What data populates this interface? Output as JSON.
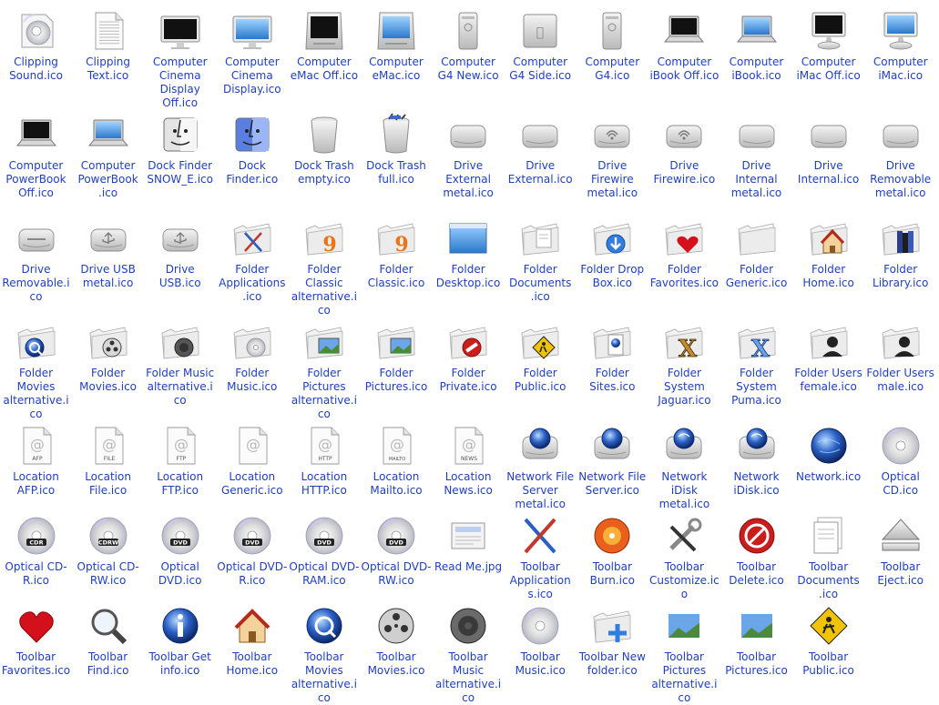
{
  "colors": {
    "label": "#1f3fc0",
    "background": "#ffffff",
    "folder": "#e8e8e8",
    "drive": "#d8d8d8",
    "screen_on": "#4da3e8",
    "screen_off": "#111111",
    "globe": "#2a5fc4",
    "heart": "#d4101c",
    "stop": "#cc1d1d"
  },
  "icons": [
    {
      "label": "Clipping Sound.ico",
      "kind": "clip-sound"
    },
    {
      "label": "Clipping Text.ico",
      "kind": "clip-text"
    },
    {
      "label": "Computer Cinema Display Off.ico",
      "kind": "display-off"
    },
    {
      "label": "Computer Cinema Display.ico",
      "kind": "display-on"
    },
    {
      "label": "Computer eMac Off.ico",
      "kind": "emac-off"
    },
    {
      "label": "Computer eMac.ico",
      "kind": "emac-on"
    },
    {
      "label": "Computer G4 New.ico",
      "kind": "g4-tower"
    },
    {
      "label": "Computer G4 Side.ico",
      "kind": "g4-side"
    },
    {
      "label": "Computer G4.ico",
      "kind": "g4-tower"
    },
    {
      "label": "Computer iBook Off.ico",
      "kind": "laptop-off"
    },
    {
      "label": "Computer iBook.ico",
      "kind": "laptop-on"
    },
    {
      "label": "Computer iMac Off.ico",
      "kind": "imac-off"
    },
    {
      "label": "Computer iMac.ico",
      "kind": "imac-on"
    },
    {
      "label": "Computer PowerBook Off.ico",
      "kind": "laptop-off"
    },
    {
      "label": "Computer PowerBook .ico",
      "kind": "laptop-on"
    },
    {
      "label": "Dock Finder SNOW_E.ico",
      "kind": "finder-snow"
    },
    {
      "label": "Dock Finder.ico",
      "kind": "finder"
    },
    {
      "label": "Dock Trash empty.ico",
      "kind": "trash-empty"
    },
    {
      "label": "Dock Trash full.ico",
      "kind": "trash-full"
    },
    {
      "label": "Drive External metal.ico",
      "kind": "drive"
    },
    {
      "label": "Drive External.ico",
      "kind": "drive"
    },
    {
      "label": "Drive Firewire metal.ico",
      "kind": "drive-firewire"
    },
    {
      "label": "Drive Firewire.ico",
      "kind": "drive-firewire"
    },
    {
      "label": "Drive Internal metal.ico",
      "kind": "drive"
    },
    {
      "label": "Drive Internal.ico",
      "kind": "drive"
    },
    {
      "label": "Drive Removable metal.ico",
      "kind": "drive"
    },
    {
      "label": "Drive Removable.ico",
      "kind": "drive-removable"
    },
    {
      "label": "Drive USB metal.ico",
      "kind": "drive-usb"
    },
    {
      "label": "Drive USB.ico",
      "kind": "drive-usb"
    },
    {
      "label": "Folder Applications.ico",
      "kind": "folder-apps"
    },
    {
      "label": "Folder Classic alternative.ico",
      "kind": "folder-classic"
    },
    {
      "label": "Folder Classic.ico",
      "kind": "folder-classic"
    },
    {
      "label": "Folder Desktop.ico",
      "kind": "folder-desktop"
    },
    {
      "label": "Folder Documents .ico",
      "kind": "folder-docs"
    },
    {
      "label": "Folder Drop Box.ico",
      "kind": "folder-drop"
    },
    {
      "label": "Folder Favorites.ico",
      "kind": "folder-fav"
    },
    {
      "label": "Folder Generic.ico",
      "kind": "folder"
    },
    {
      "label": "Folder Home.ico",
      "kind": "folder-home"
    },
    {
      "label": "Folder Library.ico",
      "kind": "folder-library"
    },
    {
      "label": "Folder Movies alternative.ico",
      "kind": "folder-qt"
    },
    {
      "label": "Folder Movies.ico",
      "kind": "folder-reel"
    },
    {
      "label": "Folder Music alternative.ico",
      "kind": "folder-speaker"
    },
    {
      "label": "Folder Music.ico",
      "kind": "folder-cd"
    },
    {
      "label": "Folder Pictures alternative.ico",
      "kind": "folder-pics"
    },
    {
      "label": "Folder Pictures.ico",
      "kind": "folder-pics"
    },
    {
      "label": "Folder Private.ico",
      "kind": "folder-private"
    },
    {
      "label": "Folder Public.ico",
      "kind": "folder-public"
    },
    {
      "label": "Folder Sites.ico",
      "kind": "folder-sites"
    },
    {
      "label": "Folder System Jaguar.ico",
      "kind": "folder-x-jaguar"
    },
    {
      "label": "Folder System Puma.ico",
      "kind": "folder-x-puma"
    },
    {
      "label": "Folder Users female.ico",
      "kind": "folder-user-f"
    },
    {
      "label": "Folder Users male.ico",
      "kind": "folder-user-m"
    },
    {
      "label": "Location AFP.ico",
      "kind": "loc",
      "tag": "AFP"
    },
    {
      "label": "Location File.ico",
      "kind": "loc",
      "tag": "FILE"
    },
    {
      "label": "Location FTP.ico",
      "kind": "loc",
      "tag": "FTP"
    },
    {
      "label": "Location Generic.ico",
      "kind": "loc",
      "tag": ""
    },
    {
      "label": "Location HTTP.ico",
      "kind": "loc",
      "tag": "HTTP"
    },
    {
      "label": "Location Mailto.ico",
      "kind": "loc",
      "tag": "MAILTO"
    },
    {
      "label": "Location News.ico",
      "kind": "loc",
      "tag": "NEWS"
    },
    {
      "label": "Network File Server metal.ico",
      "kind": "net-server"
    },
    {
      "label": "Network File Server.ico",
      "kind": "net-server"
    },
    {
      "label": "Network iDisk metal.ico",
      "kind": "net-idisk"
    },
    {
      "label": "Network iDisk.ico",
      "kind": "net-idisk"
    },
    {
      "label": "Network.ico",
      "kind": "globe"
    },
    {
      "label": "Optical CD.ico",
      "kind": "cd",
      "tag": ""
    },
    {
      "label": "Optical CD-R.ico",
      "kind": "cd",
      "tag": "CDR"
    },
    {
      "label": "Optical CD-RW.ico",
      "kind": "cd",
      "tag": "CDRW"
    },
    {
      "label": "Optical DVD.ico",
      "kind": "cd",
      "tag": "DVD"
    },
    {
      "label": "Optical DVD-R.ico",
      "kind": "cd",
      "tag": "DVD"
    },
    {
      "label": "Optical DVD-RAM.ico",
      "kind": "cd",
      "tag": "DVD"
    },
    {
      "label": "Optical DVD-RW.ico",
      "kind": "cd",
      "tag": "DVD"
    },
    {
      "label": "Read Me.jpg",
      "kind": "readme"
    },
    {
      "label": "Toolbar Application s.ico",
      "kind": "tb-apps"
    },
    {
      "label": "Toolbar Burn.ico",
      "kind": "tb-burn"
    },
    {
      "label": "Toolbar Customize.ico",
      "kind": "tb-tools"
    },
    {
      "label": "Toolbar Delete.ico",
      "kind": "tb-delete"
    },
    {
      "label": "Toolbar Documents .ico",
      "kind": "tb-docs"
    },
    {
      "label": "Toolbar Eject.ico",
      "kind": "tb-eject"
    },
    {
      "label": "Toolbar Favorites.ico",
      "kind": "tb-heart"
    },
    {
      "label": "Toolbar Find.ico",
      "kind": "tb-find"
    },
    {
      "label": "Toolbar Get info.ico",
      "kind": "tb-info"
    },
    {
      "label": "Toolbar Home.ico",
      "kind": "tb-home"
    },
    {
      "label": "Toolbar Movies alternative.ico",
      "kind": "tb-qt"
    },
    {
      "label": "Toolbar Movies.ico",
      "kind": "tb-reel"
    },
    {
      "label": "Toolbar Music alternative.ico",
      "kind": "tb-speaker"
    },
    {
      "label": "Toolbar Music.ico",
      "kind": "tb-cd"
    },
    {
      "label": "Toolbar New folder.ico",
      "kind": "tb-newfolder"
    },
    {
      "label": "Toolbar Pictures alternative.ico",
      "kind": "tb-pics"
    },
    {
      "label": "Toolbar Pictures.ico",
      "kind": "tb-pics"
    },
    {
      "label": "Toolbar Public.ico",
      "kind": "tb-public"
    }
  ]
}
